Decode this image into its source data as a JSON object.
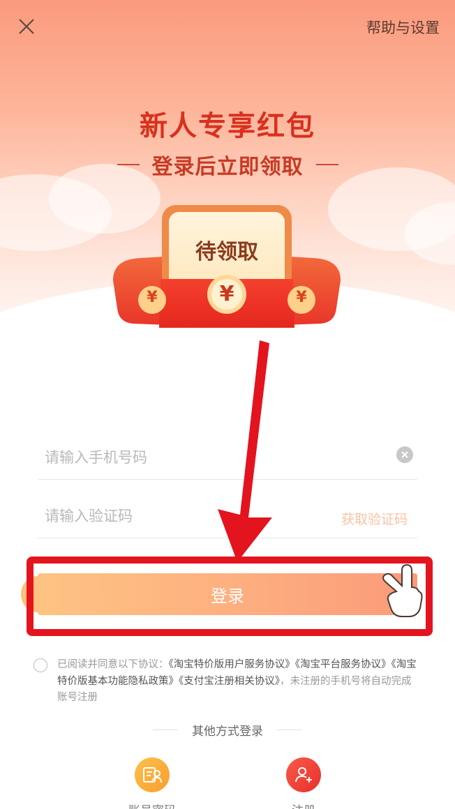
{
  "header": {
    "close_icon": "close-icon",
    "help_label": "帮助与设置"
  },
  "promo": {
    "title": "新人专享红包",
    "subtitle": "登录后立即领取",
    "envelope_label": "待领取",
    "envelope_symbol": "¥",
    "coin_symbol": "¥"
  },
  "form": {
    "phone": {
      "value": "",
      "placeholder": "请输入手机号码"
    },
    "code": {
      "value": "",
      "placeholder": "请输入验证码"
    },
    "get_code_label": "获取验证码",
    "login_label": "登录"
  },
  "agreement": {
    "prefix": "已阅读并同意以下协议：",
    "links": [
      "《淘宝特价版用户服务协议》",
      "《淘宝平台服务协议》",
      "《淘宝特价版基本功能隐私政策》",
      "《支付宝注册相关协议》"
    ],
    "suffix": "，未注册的手机号将自动完成账号注册"
  },
  "other_login": {
    "title": "其他方式登录",
    "options": [
      {
        "label": "账号密码",
        "icon": "account-password-icon",
        "color": "#fba93a"
      },
      {
        "label": "注册",
        "icon": "register-user-icon",
        "color": "#ef3f3a"
      }
    ]
  },
  "colors": {
    "accent": "#d9301e",
    "login_gradient_start": "#fec382",
    "login_gradient_end": "#fb9a79",
    "annotation_red": "#e3141e"
  }
}
